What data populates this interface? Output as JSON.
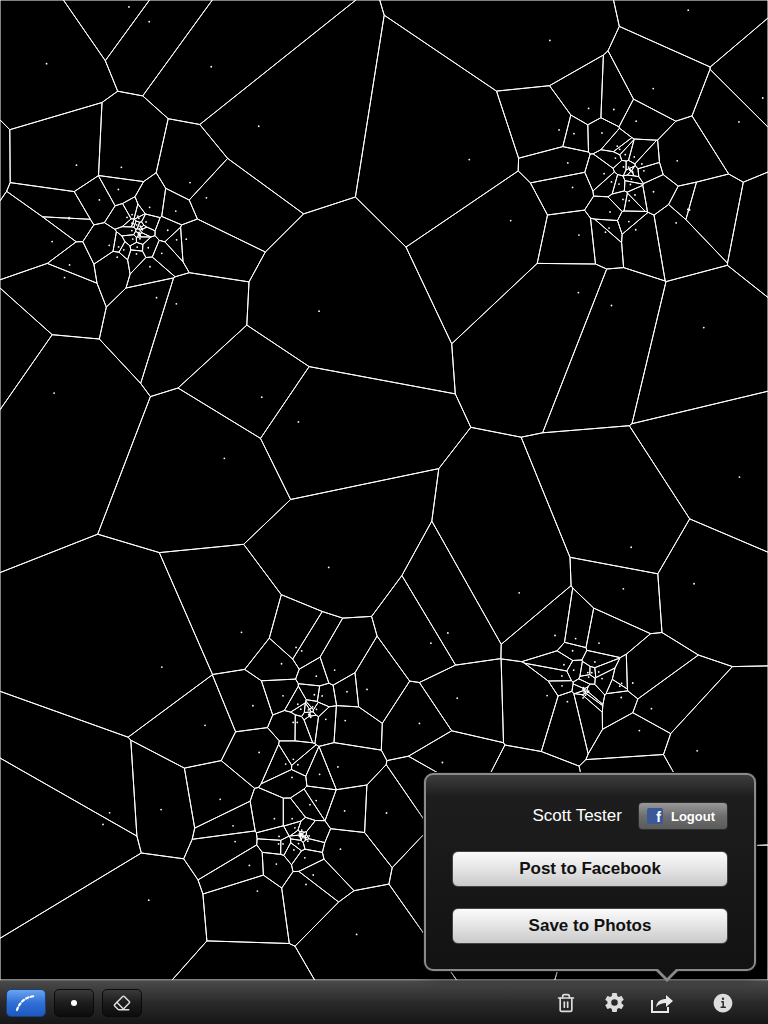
{
  "share_popover": {
    "open": true,
    "account": {
      "name": "Scott Tester",
      "service_logo": "f",
      "button": "Logout"
    },
    "actions": [
      "Post to Facebook",
      "Save to Photos"
    ]
  },
  "tools": [
    {
      "kind": "line",
      "selected": true
    },
    {
      "kind": "point",
      "selected": false
    },
    {
      "kind": "eraser",
      "selected": false
    }
  ],
  "actions": [
    {
      "kind": "trash",
      "active": false
    },
    {
      "kind": "settings",
      "active": false
    },
    {
      "kind": "share",
      "active": true
    },
    {
      "kind": "info",
      "active": false
    }
  ]
}
